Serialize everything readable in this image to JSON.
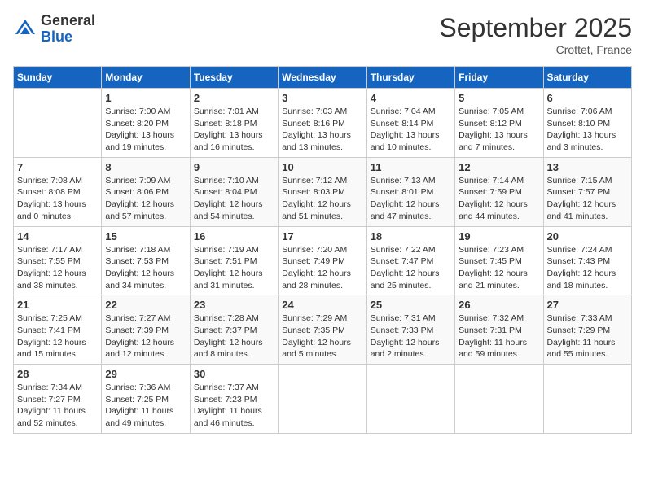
{
  "header": {
    "logo_general": "General",
    "logo_blue": "Blue",
    "month_year": "September 2025",
    "location": "Crottet, France"
  },
  "days_of_week": [
    "Sunday",
    "Monday",
    "Tuesday",
    "Wednesday",
    "Thursday",
    "Friday",
    "Saturday"
  ],
  "weeks": [
    [
      {
        "day": "",
        "info": ""
      },
      {
        "day": "1",
        "info": "Sunrise: 7:00 AM\nSunset: 8:20 PM\nDaylight: 13 hours\nand 19 minutes."
      },
      {
        "day": "2",
        "info": "Sunrise: 7:01 AM\nSunset: 8:18 PM\nDaylight: 13 hours\nand 16 minutes."
      },
      {
        "day": "3",
        "info": "Sunrise: 7:03 AM\nSunset: 8:16 PM\nDaylight: 13 hours\nand 13 minutes."
      },
      {
        "day": "4",
        "info": "Sunrise: 7:04 AM\nSunset: 8:14 PM\nDaylight: 13 hours\nand 10 minutes."
      },
      {
        "day": "5",
        "info": "Sunrise: 7:05 AM\nSunset: 8:12 PM\nDaylight: 13 hours\nand 7 minutes."
      },
      {
        "day": "6",
        "info": "Sunrise: 7:06 AM\nSunset: 8:10 PM\nDaylight: 13 hours\nand 3 minutes."
      }
    ],
    [
      {
        "day": "7",
        "info": "Sunrise: 7:08 AM\nSunset: 8:08 PM\nDaylight: 13 hours\nand 0 minutes."
      },
      {
        "day": "8",
        "info": "Sunrise: 7:09 AM\nSunset: 8:06 PM\nDaylight: 12 hours\nand 57 minutes."
      },
      {
        "day": "9",
        "info": "Sunrise: 7:10 AM\nSunset: 8:04 PM\nDaylight: 12 hours\nand 54 minutes."
      },
      {
        "day": "10",
        "info": "Sunrise: 7:12 AM\nSunset: 8:03 PM\nDaylight: 12 hours\nand 51 minutes."
      },
      {
        "day": "11",
        "info": "Sunrise: 7:13 AM\nSunset: 8:01 PM\nDaylight: 12 hours\nand 47 minutes."
      },
      {
        "day": "12",
        "info": "Sunrise: 7:14 AM\nSunset: 7:59 PM\nDaylight: 12 hours\nand 44 minutes."
      },
      {
        "day": "13",
        "info": "Sunrise: 7:15 AM\nSunset: 7:57 PM\nDaylight: 12 hours\nand 41 minutes."
      }
    ],
    [
      {
        "day": "14",
        "info": "Sunrise: 7:17 AM\nSunset: 7:55 PM\nDaylight: 12 hours\nand 38 minutes."
      },
      {
        "day": "15",
        "info": "Sunrise: 7:18 AM\nSunset: 7:53 PM\nDaylight: 12 hours\nand 34 minutes."
      },
      {
        "day": "16",
        "info": "Sunrise: 7:19 AM\nSunset: 7:51 PM\nDaylight: 12 hours\nand 31 minutes."
      },
      {
        "day": "17",
        "info": "Sunrise: 7:20 AM\nSunset: 7:49 PM\nDaylight: 12 hours\nand 28 minutes."
      },
      {
        "day": "18",
        "info": "Sunrise: 7:22 AM\nSunset: 7:47 PM\nDaylight: 12 hours\nand 25 minutes."
      },
      {
        "day": "19",
        "info": "Sunrise: 7:23 AM\nSunset: 7:45 PM\nDaylight: 12 hours\nand 21 minutes."
      },
      {
        "day": "20",
        "info": "Sunrise: 7:24 AM\nSunset: 7:43 PM\nDaylight: 12 hours\nand 18 minutes."
      }
    ],
    [
      {
        "day": "21",
        "info": "Sunrise: 7:25 AM\nSunset: 7:41 PM\nDaylight: 12 hours\nand 15 minutes."
      },
      {
        "day": "22",
        "info": "Sunrise: 7:27 AM\nSunset: 7:39 PM\nDaylight: 12 hours\nand 12 minutes."
      },
      {
        "day": "23",
        "info": "Sunrise: 7:28 AM\nSunset: 7:37 PM\nDaylight: 12 hours\nand 8 minutes."
      },
      {
        "day": "24",
        "info": "Sunrise: 7:29 AM\nSunset: 7:35 PM\nDaylight: 12 hours\nand 5 minutes."
      },
      {
        "day": "25",
        "info": "Sunrise: 7:31 AM\nSunset: 7:33 PM\nDaylight: 12 hours\nand 2 minutes."
      },
      {
        "day": "26",
        "info": "Sunrise: 7:32 AM\nSunset: 7:31 PM\nDaylight: 11 hours\nand 59 minutes."
      },
      {
        "day": "27",
        "info": "Sunrise: 7:33 AM\nSunset: 7:29 PM\nDaylight: 11 hours\nand 55 minutes."
      }
    ],
    [
      {
        "day": "28",
        "info": "Sunrise: 7:34 AM\nSunset: 7:27 PM\nDaylight: 11 hours\nand 52 minutes."
      },
      {
        "day": "29",
        "info": "Sunrise: 7:36 AM\nSunset: 7:25 PM\nDaylight: 11 hours\nand 49 minutes."
      },
      {
        "day": "30",
        "info": "Sunrise: 7:37 AM\nSunset: 7:23 PM\nDaylight: 11 hours\nand 46 minutes."
      },
      {
        "day": "",
        "info": ""
      },
      {
        "day": "",
        "info": ""
      },
      {
        "day": "",
        "info": ""
      },
      {
        "day": "",
        "info": ""
      }
    ]
  ]
}
